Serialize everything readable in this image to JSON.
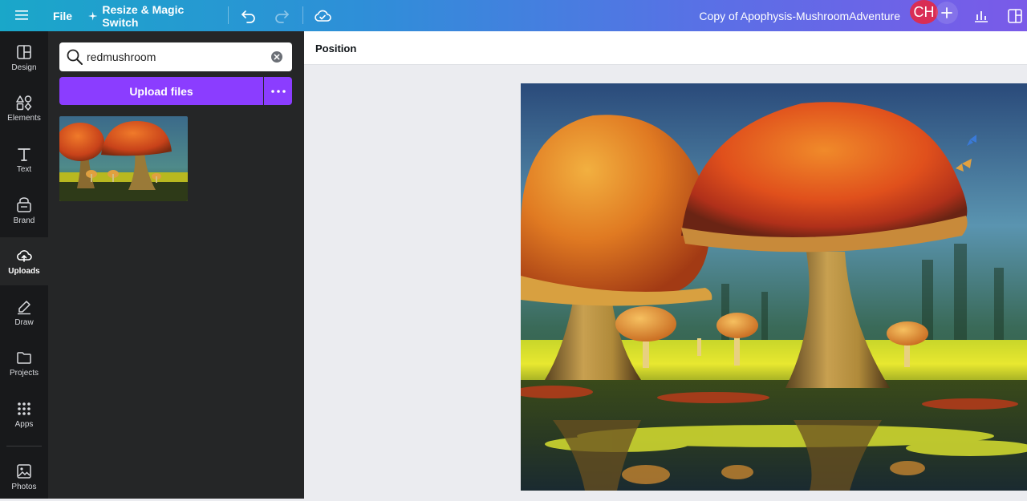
{
  "topbar": {
    "file_label": "File",
    "resize_label": "Resize & Magic Switch",
    "doc_title": "Copy of Apophysis-MushroomAdventure",
    "avatar_initials": "CH"
  },
  "rail": {
    "items": [
      {
        "label": "Design"
      },
      {
        "label": "Elements"
      },
      {
        "label": "Text"
      },
      {
        "label": "Brand"
      },
      {
        "label": "Uploads"
      },
      {
        "label": "Draw"
      },
      {
        "label": "Projects"
      },
      {
        "label": "Apps"
      },
      {
        "label": "Photos"
      }
    ],
    "active": "Uploads"
  },
  "panel": {
    "search_value": "redmushroom",
    "upload_label": "Upload files"
  },
  "context_bar": {
    "position_label": "Position"
  },
  "colors": {
    "accent_purple": "#8b3dff",
    "avatar_red": "#d92d55",
    "rail_bg": "#18191b",
    "panel_bg": "#252627"
  }
}
